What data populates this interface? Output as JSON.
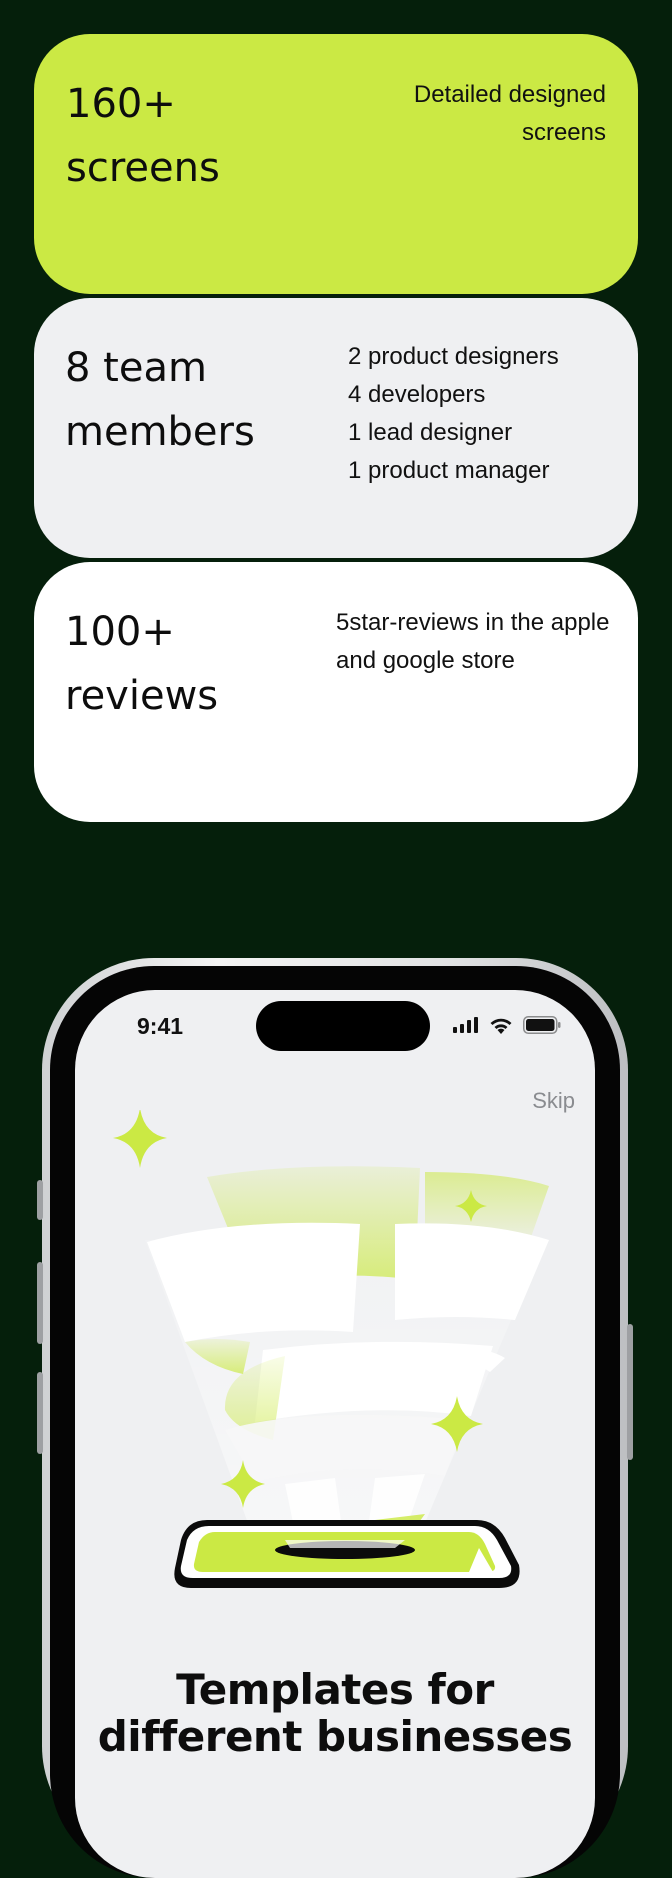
{
  "stats": [
    {
      "big_line1": "160+",
      "big_line2": "screens",
      "desc_lines": [
        "Detailed designed screens"
      ]
    },
    {
      "big_line1": "8 team",
      "big_line2": "members",
      "desc_lines": [
        "2 product designers",
        "4 developers",
        "1 lead designer",
        "1 product manager"
      ]
    },
    {
      "big_line1": "100+",
      "big_line2": "reviews",
      "desc_lines": [
        "5star-reviews in the apple and google store"
      ]
    }
  ],
  "phone": {
    "status_time": "9:41",
    "skip_label": "Skip",
    "headline_line1": "Templates for",
    "headline_line2": "different businesses"
  },
  "colors": {
    "background": "#051f0b",
    "accent_lime": "#cbe944",
    "card_gray": "#eff0f2",
    "card_white": "#ffffff"
  },
  "icons": [
    "signal-icon",
    "wifi-icon",
    "battery-icon",
    "sparkle-icon",
    "funnel-illustration"
  ]
}
